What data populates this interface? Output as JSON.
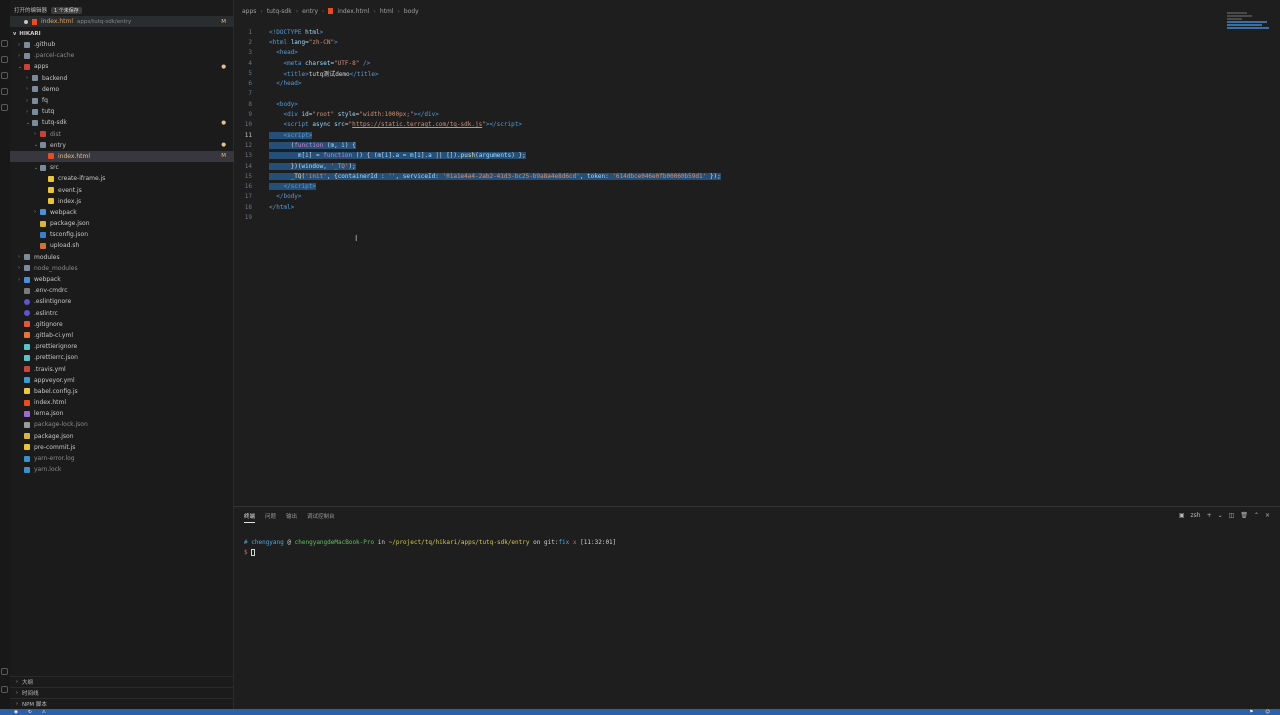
{
  "open_editors": {
    "title": "打开的编辑器",
    "badge": "1 个未保存",
    "file": {
      "name": "index.html",
      "path": "apps/tutq-sdk/entry",
      "status": "M"
    }
  },
  "explorer": {
    "root": "HIKARI",
    "items": [
      {
        "label": ".github",
        "indent": 1,
        "kind": "folder",
        "chev": ">",
        "dim": false,
        "mark": ""
      },
      {
        "label": ".parcel-cache",
        "indent": 1,
        "kind": "folder",
        "chev": ">",
        "dim": true,
        "mark": ""
      },
      {
        "label": "apps",
        "indent": 1,
        "kind": "folder-red",
        "chev": "v",
        "dim": false,
        "mark": "●"
      },
      {
        "label": "backend",
        "indent": 2,
        "kind": "folder",
        "chev": ">",
        "dim": false,
        "mark": ""
      },
      {
        "label": "demo",
        "indent": 2,
        "kind": "folder",
        "chev": ">",
        "dim": false,
        "mark": ""
      },
      {
        "label": "fq",
        "indent": 2,
        "kind": "folder",
        "chev": ">",
        "dim": false,
        "mark": ""
      },
      {
        "label": "tutq",
        "indent": 2,
        "kind": "folder",
        "chev": ">",
        "dim": false,
        "mark": ""
      },
      {
        "label": "tutq-sdk",
        "indent": 2,
        "kind": "folder",
        "chev": "v",
        "dim": false,
        "mark": "●"
      },
      {
        "label": "dist",
        "indent": 3,
        "kind": "folder-red",
        "chev": ">",
        "dim": true,
        "mark": ""
      },
      {
        "label": "entry",
        "indent": 3,
        "kind": "folder",
        "chev": "v",
        "dim": false,
        "mark": "●"
      },
      {
        "label": "index.html",
        "indent": 4,
        "kind": "html",
        "chev": "",
        "dim": false,
        "mark": "M",
        "selected": true
      },
      {
        "label": "src",
        "indent": 3,
        "kind": "folder",
        "chev": "v",
        "dim": false,
        "mark": ""
      },
      {
        "label": "create-iframe.js",
        "indent": 4,
        "kind": "js",
        "chev": "",
        "dim": false,
        "mark": ""
      },
      {
        "label": "event.js",
        "indent": 4,
        "kind": "js",
        "chev": "",
        "dim": false,
        "mark": ""
      },
      {
        "label": "index.js",
        "indent": 4,
        "kind": "js",
        "chev": "",
        "dim": false,
        "mark": ""
      },
      {
        "label": "webpack",
        "indent": 3,
        "kind": "folder-blue",
        "chev": ">",
        "dim": false,
        "mark": ""
      },
      {
        "label": "package.json",
        "indent": 3,
        "kind": "json",
        "chev": "",
        "dim": false,
        "mark": ""
      },
      {
        "label": "tsconfig.json",
        "indent": 3,
        "kind": "ts",
        "chev": "",
        "dim": false,
        "mark": ""
      },
      {
        "label": "upload.sh",
        "indent": 3,
        "kind": "sh",
        "chev": "",
        "dim": false,
        "mark": ""
      },
      {
        "label": "modules",
        "indent": 1,
        "kind": "folder",
        "chev": ">",
        "dim": false,
        "mark": ""
      },
      {
        "label": "node_modules",
        "indent": 1,
        "kind": "folder",
        "chev": ">",
        "dim": true,
        "mark": ""
      },
      {
        "label": "webpack",
        "indent": 1,
        "kind": "folder-blue",
        "chev": ">",
        "dim": false,
        "mark": ""
      },
      {
        "label": ".env-cmdrc",
        "indent": 1,
        "kind": "text",
        "chev": "",
        "dim": false,
        "mark": ""
      },
      {
        "label": ".eslintignore",
        "indent": 1,
        "kind": "eslint",
        "chev": "",
        "dim": false,
        "mark": ""
      },
      {
        "label": ".eslintrc",
        "indent": 1,
        "kind": "eslint",
        "chev": "",
        "dim": false,
        "mark": ""
      },
      {
        "label": ".gitignore",
        "indent": 1,
        "kind": "git",
        "chev": "",
        "dim": false,
        "mark": ""
      },
      {
        "label": ".gitlab-ci.yml",
        "indent": 1,
        "kind": "gitlab",
        "chev": "",
        "dim": false,
        "mark": ""
      },
      {
        "label": ".prettierignore",
        "indent": 1,
        "kind": "prettier",
        "chev": "",
        "dim": false,
        "mark": ""
      },
      {
        "label": ".prettierrc.json",
        "indent": 1,
        "kind": "prettier",
        "chev": "",
        "dim": false,
        "mark": ""
      },
      {
        "label": ".travis.yml",
        "indent": 1,
        "kind": "travis",
        "chev": "",
        "dim": false,
        "mark": ""
      },
      {
        "label": "appveyor.yml",
        "indent": 1,
        "kind": "appveyor",
        "chev": "",
        "dim": false,
        "mark": ""
      },
      {
        "label": "babel.config.js",
        "indent": 1,
        "kind": "babel",
        "chev": "",
        "dim": false,
        "mark": ""
      },
      {
        "label": "index.html",
        "indent": 1,
        "kind": "html",
        "chev": "",
        "dim": false,
        "mark": ""
      },
      {
        "label": "lerna.json",
        "indent": 1,
        "kind": "lerna",
        "chev": "",
        "dim": false,
        "mark": ""
      },
      {
        "label": "package-lock.json",
        "indent": 1,
        "kind": "npm",
        "chev": "",
        "dim": true,
        "mark": ""
      },
      {
        "label": "package.json",
        "indent": 1,
        "kind": "json",
        "chev": "",
        "dim": false,
        "mark": ""
      },
      {
        "label": "pre-commit.js",
        "indent": 1,
        "kind": "js",
        "chev": "",
        "dim": false,
        "mark": ""
      },
      {
        "label": "yarn-error.log",
        "indent": 1,
        "kind": "yarn",
        "chev": "",
        "dim": true,
        "mark": ""
      },
      {
        "label": "yarn.lock",
        "indent": 1,
        "kind": "yarn",
        "chev": "",
        "dim": true,
        "mark": ""
      }
    ],
    "bottom_sections": [
      "大纲",
      "时间线",
      "NPM 脚本"
    ]
  },
  "breadcrumb": [
    "apps",
    "tutq-sdk",
    "entry",
    "index.html",
    "html",
    "body"
  ],
  "code_lines": [
    {
      "n": "1",
      "html": "<span class='tag'>&lt;!DOCTYPE</span> <span class='attr'>html</span><span class='tag'>&gt;</span>"
    },
    {
      "n": "2",
      "html": "<span class='tag'>&lt;html</span> <span class='attr'>lang</span>=<span class='str'>\"zh-CN\"</span><span class='tag'>&gt;</span>"
    },
    {
      "n": "3",
      "html": "  <span class='tag'>&lt;head&gt;</span>"
    },
    {
      "n": "4",
      "html": "    <span class='tag'>&lt;meta</span> <span class='attr'>charset</span>=<span class='str'>\"UTF-8\"</span> <span class='tag'>/&gt;</span>"
    },
    {
      "n": "5",
      "html": "    <span class='tag'>&lt;title&gt;</span>tutq测试demo<span class='tag'>&lt;/title&gt;</span>"
    },
    {
      "n": "6",
      "html": "  <span class='tag'>&lt;/head&gt;</span>"
    },
    {
      "n": "7",
      "html": ""
    },
    {
      "n": "8",
      "html": "  <span class='tag'>&lt;body&gt;</span>"
    },
    {
      "n": "9",
      "html": "    <span class='tag'>&lt;div</span> <span class='attr'>id</span>=<span class='str'>\"root\"</span> <span class='attr'>style</span>=<span class='str'>\"width:1000px;\"</span><span class='tag'>&gt;&lt;/div&gt;</span>"
    },
    {
      "n": "10",
      "html": "    <span class='tag'>&lt;script</span> <span class='attr'>async</span> <span class='attr'>src</span>=<span class='str'>\"</span><span class='url'>https://static.terraqt.com/tq-sdk.js</span><span class='str'>\"</span><span class='tag'>&gt;&lt;/script&gt;</span>"
    },
    {
      "n": "11",
      "html": "    <span class='tag'>&lt;script&gt;</span>",
      "hl": true,
      "cur": true
    },
    {
      "n": "12",
      "html": "      (<span class='kw'>function</span> (<span class='attr'>m</span>, <span class='attr'>i</span>) {",
      "hl": true
    },
    {
      "n": "13",
      "html": "        <span class='attr'>m</span>[<span class='attr'>i</span>] = <span class='kw'>function</span> () { (<span class='attr'>m</span>[<span class='attr'>i</span>].<span class='attr'>a</span> = <span class='attr'>m</span>[<span class='attr'>i</span>].<span class='attr'>a</span> || []).<span class='fn'>push</span>(<span class='attr'>arguments</span>) };",
      "hl": true
    },
    {
      "n": "14",
      "html": "      })(<span class='attr'>window</span>, <span class='str'>'_TQ'</span>);",
      "hl": true
    },
    {
      "n": "15",
      "html": "      <span class='fn'>_TQ</span>(<span class='str'>'init'</span>, {<span class='attr'>containerId</span> : <span class='str'>''</span>, <span class='attr'>serviceId</span>: <span class='str'>'01a1e4a4-2ab2-41d3-bc25-b9a8a4e8d6cd'</span>, <span class='attr'>token</span>: <span class='str'>'614dbce046e0fb00060b59d1'</span> });",
      "hl": true
    },
    {
      "n": "16",
      "html": "    <span class='tag'>&lt;/script&gt;</span>",
      "hl": true
    },
    {
      "n": "17",
      "html": "  <span class='tag'>&lt;/body&gt;</span>"
    },
    {
      "n": "18",
      "html": "<span class='tag'>&lt;/html&gt;</span>"
    },
    {
      "n": "19",
      "html": ""
    }
  ],
  "panel": {
    "tabs": [
      "终端",
      "问题",
      "输出",
      "调试控制台"
    ],
    "shell": "zsh",
    "prompt": {
      "hash": "#",
      "user": "chengyang",
      "at": "@",
      "host": "chengyangdeMacBook-Pro",
      "in": "in",
      "path": "~/project/tq/hikari/apps/tutq-sdk/entry",
      "on": "on",
      "git": "git:",
      "branch": "fix",
      "x": "x",
      "time": "[11:32:01]",
      "dollar": "$"
    }
  },
  "colors": {
    "accent": "#2a61a8",
    "selection": "#264f78"
  }
}
